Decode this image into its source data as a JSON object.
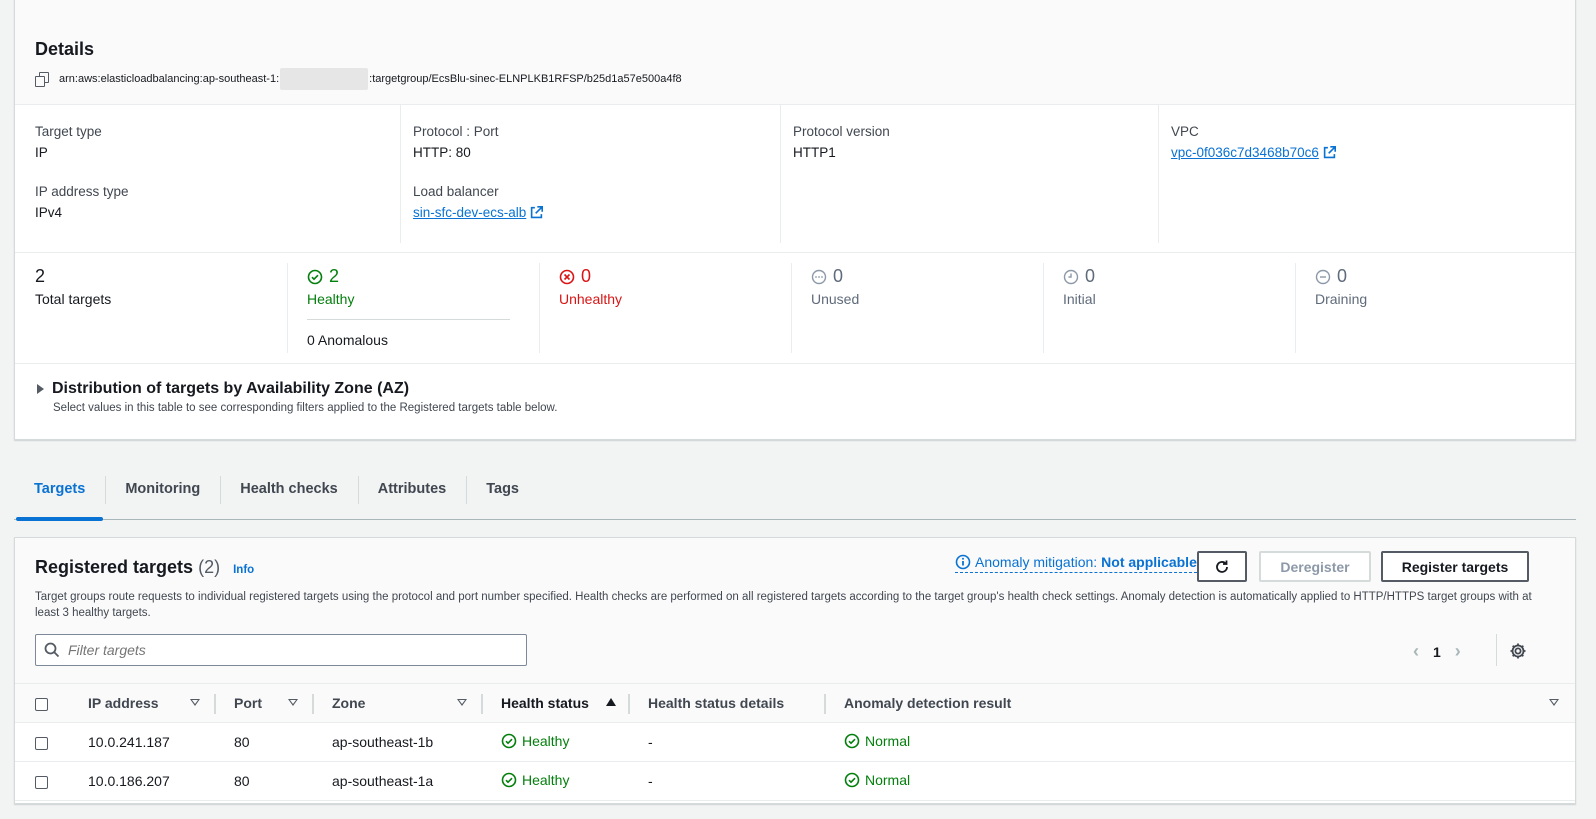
{
  "details": {
    "title": "Details",
    "arn_prefix": "arn:aws:elasticloadbalancing:ap-southeast-1:",
    "arn_suffix": ":targetgroup/EcsBlu-sinec-ELNPLKB1RFSP/b25d1a57e500a4f8",
    "properties": {
      "target_type_label": "Target type",
      "target_type_value": "IP",
      "ip_address_type_label": "IP address type",
      "ip_address_type_value": "IPv4",
      "protocol_port_label": "Protocol : Port",
      "protocol_port_value": "HTTP: 80",
      "load_balancer_label": "Load balancer",
      "load_balancer_value": "sin-sfc-dev-ecs-alb",
      "protocol_version_label": "Protocol version",
      "protocol_version_value": "HTTP1",
      "vpc_label": "VPC",
      "vpc_value": "vpc-0f036c7d3468b70c6"
    },
    "stats": {
      "total": {
        "value": "2",
        "label": "Total targets"
      },
      "healthy": {
        "value": "2",
        "label": "Healthy"
      },
      "anomalous": "0 Anomalous",
      "unhealthy": {
        "value": "0",
        "label": "Unhealthy"
      },
      "unused": {
        "value": "0",
        "label": "Unused"
      },
      "initial": {
        "value": "0",
        "label": "Initial"
      },
      "draining": {
        "value": "0",
        "label": "Draining"
      }
    },
    "az": {
      "title": "Distribution of targets by Availability Zone (AZ)",
      "subtitle": "Select values in this table to see corresponding filters applied to the Registered targets table below."
    }
  },
  "tabs": [
    "Targets",
    "Monitoring",
    "Health checks",
    "Attributes",
    "Tags"
  ],
  "registered": {
    "title": "Registered targets",
    "count": "(2)",
    "info": "Info",
    "description": "Target groups route requests to individual registered targets using the protocol and port number specified. Health checks are performed on all registered targets according to the target group's health check settings. Anomaly detection is automatically applied to HTTP/HTTPS target groups with at least 3 healthy targets.",
    "anomaly_mitigation_label": "Anomaly mitigation:",
    "anomaly_mitigation_value": "Not applicable",
    "deregister_label": "Deregister",
    "register_label": "Register targets",
    "filter_placeholder": "Filter targets",
    "page": "1",
    "columns": [
      "IP address",
      "Port",
      "Zone",
      "Health status",
      "Health status details",
      "Anomaly detection result"
    ],
    "rows": [
      {
        "ip": "10.0.241.187",
        "port": "80",
        "zone": "ap-southeast-1b",
        "health": "Healthy",
        "details": "-",
        "anomaly": "Normal"
      },
      {
        "ip": "10.0.186.207",
        "port": "80",
        "zone": "ap-southeast-1a",
        "health": "Healthy",
        "details": "-",
        "anomaly": "Normal"
      }
    ]
  },
  "colors": {
    "link": "#0972d3",
    "healthy": "#037f0c",
    "unhealthy": "#d91515",
    "muted": "#5f6b7a"
  }
}
